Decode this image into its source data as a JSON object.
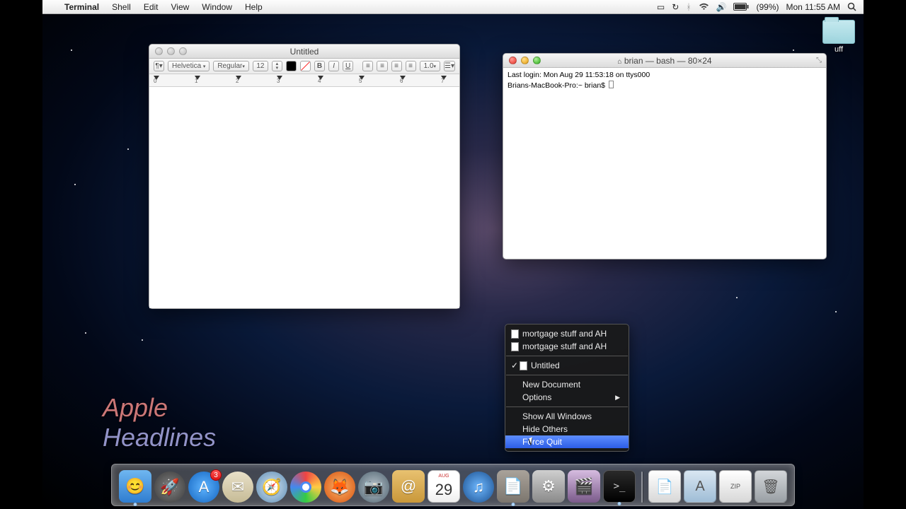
{
  "menubar": {
    "app": "Terminal",
    "items": [
      "Shell",
      "Edit",
      "View",
      "Window",
      "Help"
    ],
    "battery": "(99%)",
    "clock": "Mon 11:55 AM"
  },
  "desktop_folder": {
    "label": "uff"
  },
  "textedit": {
    "title": "Untitled",
    "font_family": "Helvetica",
    "font_style": "Regular",
    "font_size": "12",
    "spacing": "1.0",
    "ruler_labels": [
      "0",
      "1",
      "2",
      "3",
      "4",
      "5",
      "6",
      "7"
    ]
  },
  "terminal": {
    "title": "brian — bash — 80×24",
    "title_icon": "home-icon",
    "line1": "Last login: Mon Aug 29 11:53:18 on ttys000",
    "prompt": "Brians-MacBook-Pro:~ brian$ "
  },
  "context_menu": {
    "recent": [
      "mortgage stuff and AH",
      "mortgage stuff and AH"
    ],
    "windows": [
      {
        "label": "Untitled",
        "checked": true
      }
    ],
    "new_document": "New Document",
    "options": "Options",
    "show_all": "Show All Windows",
    "hide_others": "Hide Others",
    "force_quit": "Force Quit"
  },
  "dock": {
    "apps": [
      {
        "name": "finder",
        "color": "linear-gradient(#6fb6f0,#2f7dd0)",
        "glyph": "😊",
        "running": true
      },
      {
        "name": "launchpad",
        "color": "radial-gradient(circle,#828282,#3a3a3a)",
        "glyph": "🚀",
        "running": false
      },
      {
        "name": "appstore",
        "color": "radial-gradient(circle,#5eb4ff,#1465c0)",
        "glyph": "A",
        "badge": "3",
        "running": false
      },
      {
        "name": "mail",
        "color": "linear-gradient(#e8e0c8,#c6bb96)",
        "glyph": "✉",
        "running": false
      },
      {
        "name": "safari",
        "color": "radial-gradient(circle,#d7e6f2,#5c8cb4)",
        "glyph": "🧭",
        "running": false
      },
      {
        "name": "chrome",
        "color": "conic-gradient(#e44,#fc4,#3c4,#48e,#e44)",
        "glyph": "",
        "running": false
      },
      {
        "name": "firefox",
        "color": "radial-gradient(circle,#ffb366,#d45312)",
        "glyph": "🦊",
        "running": false
      },
      {
        "name": "facetime",
        "color": "radial-gradient(circle,#b9c4cc,#4f6370)",
        "glyph": "📷",
        "running": false
      },
      {
        "name": "contacts",
        "color": "linear-gradient(#e8c170,#c9983a)",
        "glyph": "@",
        "running": false
      },
      {
        "name": "ical",
        "color": "linear-gradient(#fff 55%,#eee)",
        "glyph": "",
        "running": false,
        "cal_month": "AUG",
        "cal_day": "29"
      },
      {
        "name": "itunes",
        "color": "radial-gradient(circle,#6eb8ff,#1b4f8f)",
        "glyph": "♫",
        "running": false
      },
      {
        "name": "textedit",
        "color": "linear-gradient(#a9a29a,#7c766e)",
        "glyph": "📄",
        "running": true
      },
      {
        "name": "sysprefs",
        "color": "linear-gradient(#cfcfcf,#8a8a8a)",
        "glyph": "⚙",
        "running": false
      },
      {
        "name": "imovie",
        "color": "linear-gradient(#d6bce0,#7a5a8a)",
        "glyph": "🎬",
        "running": false
      },
      {
        "name": "terminal",
        "color": "linear-gradient(#2a2a2a,#000)",
        "glyph": ">_",
        "running": true
      }
    ],
    "stacks": [
      {
        "name": "stack-doc",
        "glyph": "📄",
        "color": "linear-gradient(#fff,#d8d8d8)"
      },
      {
        "name": "stack-apps",
        "glyph": "A",
        "color": "linear-gradient(#d9e6f2,#9fbdd6)"
      },
      {
        "name": "stack-zip",
        "glyph": "ZIP",
        "color": "linear-gradient(#fff,#d8d8d8)"
      },
      {
        "name": "trash",
        "glyph": "🗑",
        "color": "linear-gradient(#d3d6d9,#9aa0a5)"
      }
    ]
  },
  "watermark": {
    "line1": "Apple",
    "line2": "Headlines"
  }
}
